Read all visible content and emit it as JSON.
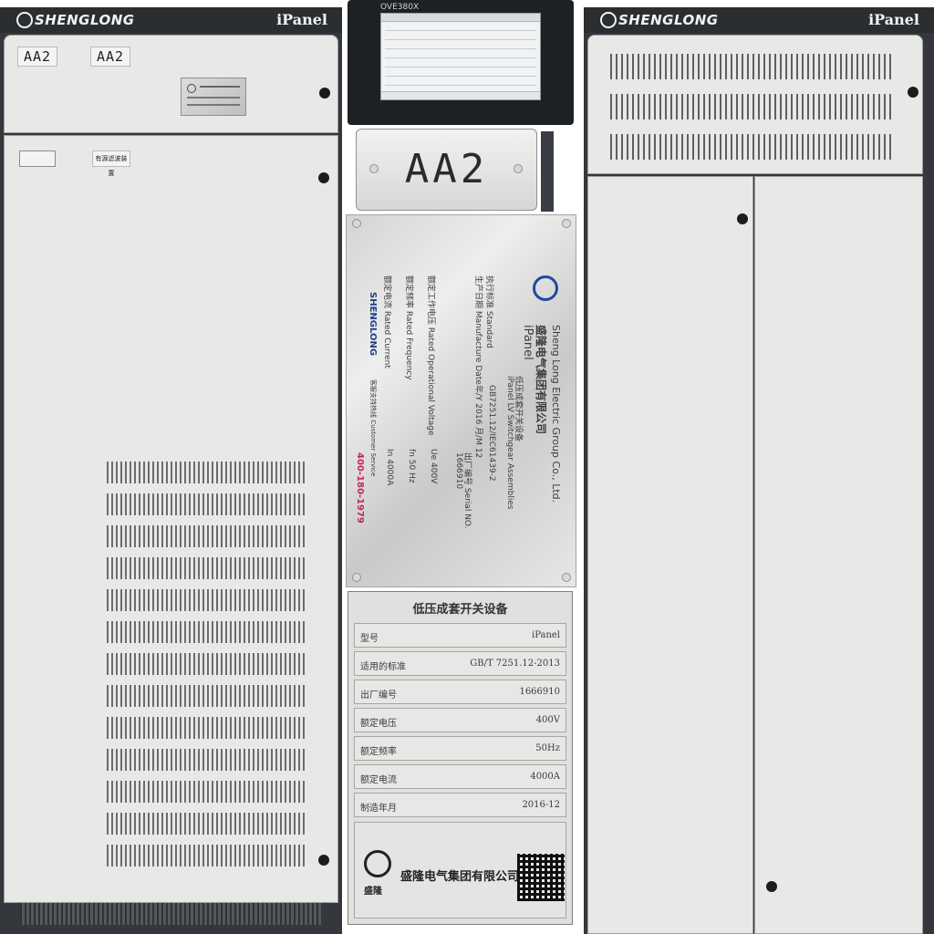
{
  "brand": {
    "logo_text": "SHENGLONG",
    "model": "iPanel"
  },
  "left_cabinet": {
    "tag_left": "AA2",
    "tag_right": "AA2",
    "label_plate": "有源滤波装置"
  },
  "hmi": {
    "model": "OVE380X"
  },
  "aa2_plate": {
    "text": "AA2"
  },
  "steel_nameplate": {
    "company_cn": "盛隆电气集团有限公司",
    "company_en": "Sheng Long Electric Group Co., Ltd.",
    "product": "iPanel",
    "product_cn": "低压成套开关设备",
    "product_en": "iPanel LV Switchgear Assemblies",
    "rows": [
      {
        "label": "执行标准 Standard",
        "value": "GB7251.12/IEC61439-2"
      },
      {
        "label": "生产日期 Manufacture Date",
        "value": "年/Y 2016 月/M 12"
      },
      {
        "label": "出厂编号 Serial NO.",
        "value": "1666910"
      },
      {
        "label": "额定工作电压 Rated Operational Voltage",
        "value": "Ue 400V"
      },
      {
        "label": "额定频率 Rated Frequency",
        "value": "fn 50 Hz"
      },
      {
        "label": "额定电流 Rated Current",
        "value": "In 4000A"
      }
    ],
    "service_label": "客服支持热线 Customer Service",
    "service_phone": "400-180-1979"
  },
  "spec_plate": {
    "title": "低压成套开关设备",
    "rows": [
      {
        "label": "型号",
        "value": "iPanel"
      },
      {
        "label": "适用的标准",
        "value": "GB/T 7251.12-2013"
      },
      {
        "label": "出厂编号",
        "value": "1666910"
      },
      {
        "label": "额定电压",
        "value": "400V"
      },
      {
        "label": "额定频率",
        "value": "50Hz"
      },
      {
        "label": "额定电流",
        "value": "4000A"
      },
      {
        "label": "制造年月",
        "value": "2016-12"
      }
    ],
    "company": "盛隆电气集团有限公司",
    "logo_caption": "盛隆"
  },
  "colors": {
    "cabinet_frame": "#34383c",
    "panel": "#e8e9e7",
    "steel": "#d9dad8"
  }
}
